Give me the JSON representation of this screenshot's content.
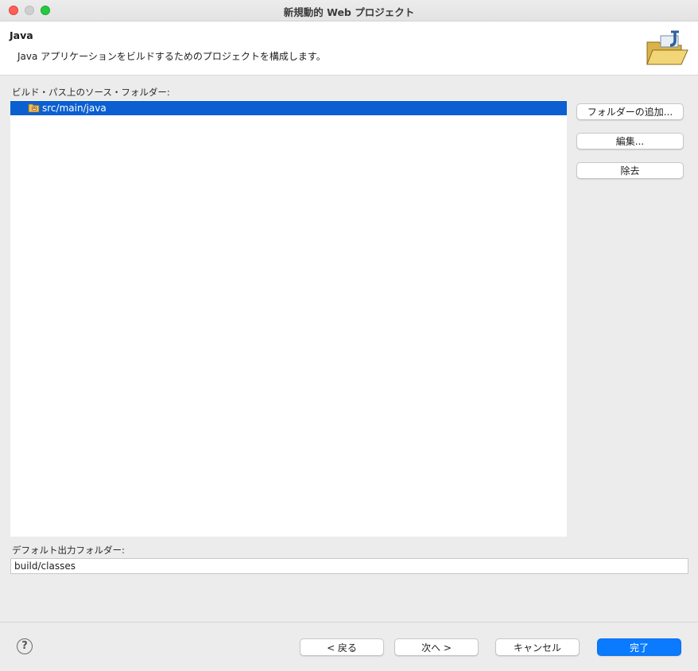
{
  "window": {
    "title": "新規動的 Web プロジェクト"
  },
  "header": {
    "title": "Java",
    "description": "Java アプリケーションをビルドするためのプロジェクトを構成します。",
    "icon": "java-folder-wizard-icon"
  },
  "source_folders": {
    "label": "ビルド・パス上のソース・フォルダー:",
    "items": [
      {
        "label": "src/main/java",
        "icon": "source-folder-icon",
        "selected": true
      }
    ]
  },
  "side_buttons": {
    "add_folder": "フォルダーの追加...",
    "edit": "編集...",
    "remove": "除去"
  },
  "output": {
    "label": "デフォルト出力フォルダー:",
    "value": "build/classes"
  },
  "footer": {
    "help": "?",
    "back": "< 戻る",
    "next": "次へ >",
    "cancel": "キャンセル",
    "finish": "完了"
  },
  "colors": {
    "selection": "#0b5fd1",
    "primary_button": "#0a7aff"
  }
}
